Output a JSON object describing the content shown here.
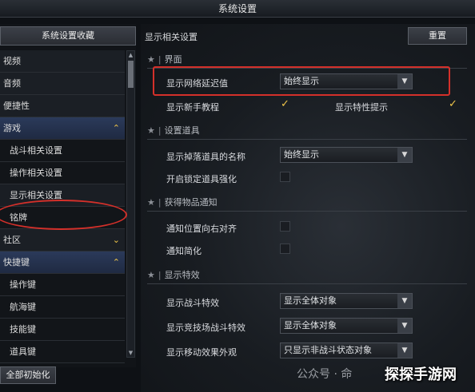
{
  "window": {
    "title": "系统设置"
  },
  "left": {
    "fav_button": "系统设置收藏",
    "items": [
      {
        "label": "视频",
        "type": "cat"
      },
      {
        "label": "音频",
        "type": "cat"
      },
      {
        "label": "便捷性",
        "type": "cat"
      },
      {
        "label": "游戏",
        "type": "cat-open",
        "chevron": "⌃"
      },
      {
        "label": "战斗相关设置",
        "type": "sub"
      },
      {
        "label": "操作相关设置",
        "type": "sub"
      },
      {
        "label": "显示相关设置",
        "type": "sub-active"
      },
      {
        "label": "铭牌",
        "type": "sub"
      },
      {
        "label": "社区",
        "type": "cat",
        "chevron": "⌄"
      },
      {
        "label": "快捷键",
        "type": "cat-open",
        "chevron": "⌃"
      },
      {
        "label": "操作键",
        "type": "sub"
      },
      {
        "label": "航海键",
        "type": "sub"
      },
      {
        "label": "技能键",
        "type": "sub"
      },
      {
        "label": "道具键",
        "type": "sub"
      }
    ],
    "reset_all": "全部初始化"
  },
  "main": {
    "title": "显示相关设置",
    "reset": "重置",
    "sections": {
      "ui": "界面",
      "items": "设置道具",
      "acquire": "获得物品通知",
      "effects": "显示特效"
    },
    "ui": {
      "latency_label": "显示网络延迟值",
      "latency_value": "始终显示",
      "tutorial_label": "显示新手教程",
      "trait_label": "显示特性提示"
    },
    "items": {
      "drop_name_label": "显示掉落道具的名称",
      "drop_name_value": "始终显示",
      "lock_label": "开启锁定道具强化"
    },
    "acquire": {
      "align_label": "通知位置向右对齐",
      "simple_label": "通知简化"
    },
    "effects": {
      "battle_label": "显示战斗特效",
      "battle_value": "显示全体对象",
      "arena_label": "显示竞技场战斗特效",
      "arena_value": "显示全体对象",
      "move_label": "显示移动效果外观",
      "move_value": "只显示非战斗状态对象"
    }
  },
  "watermark": {
    "left": "公众号 · 命",
    "brand": "探探手游网"
  },
  "colors": {
    "accent": "#f0c64a",
    "highlight": "#d4302a"
  }
}
